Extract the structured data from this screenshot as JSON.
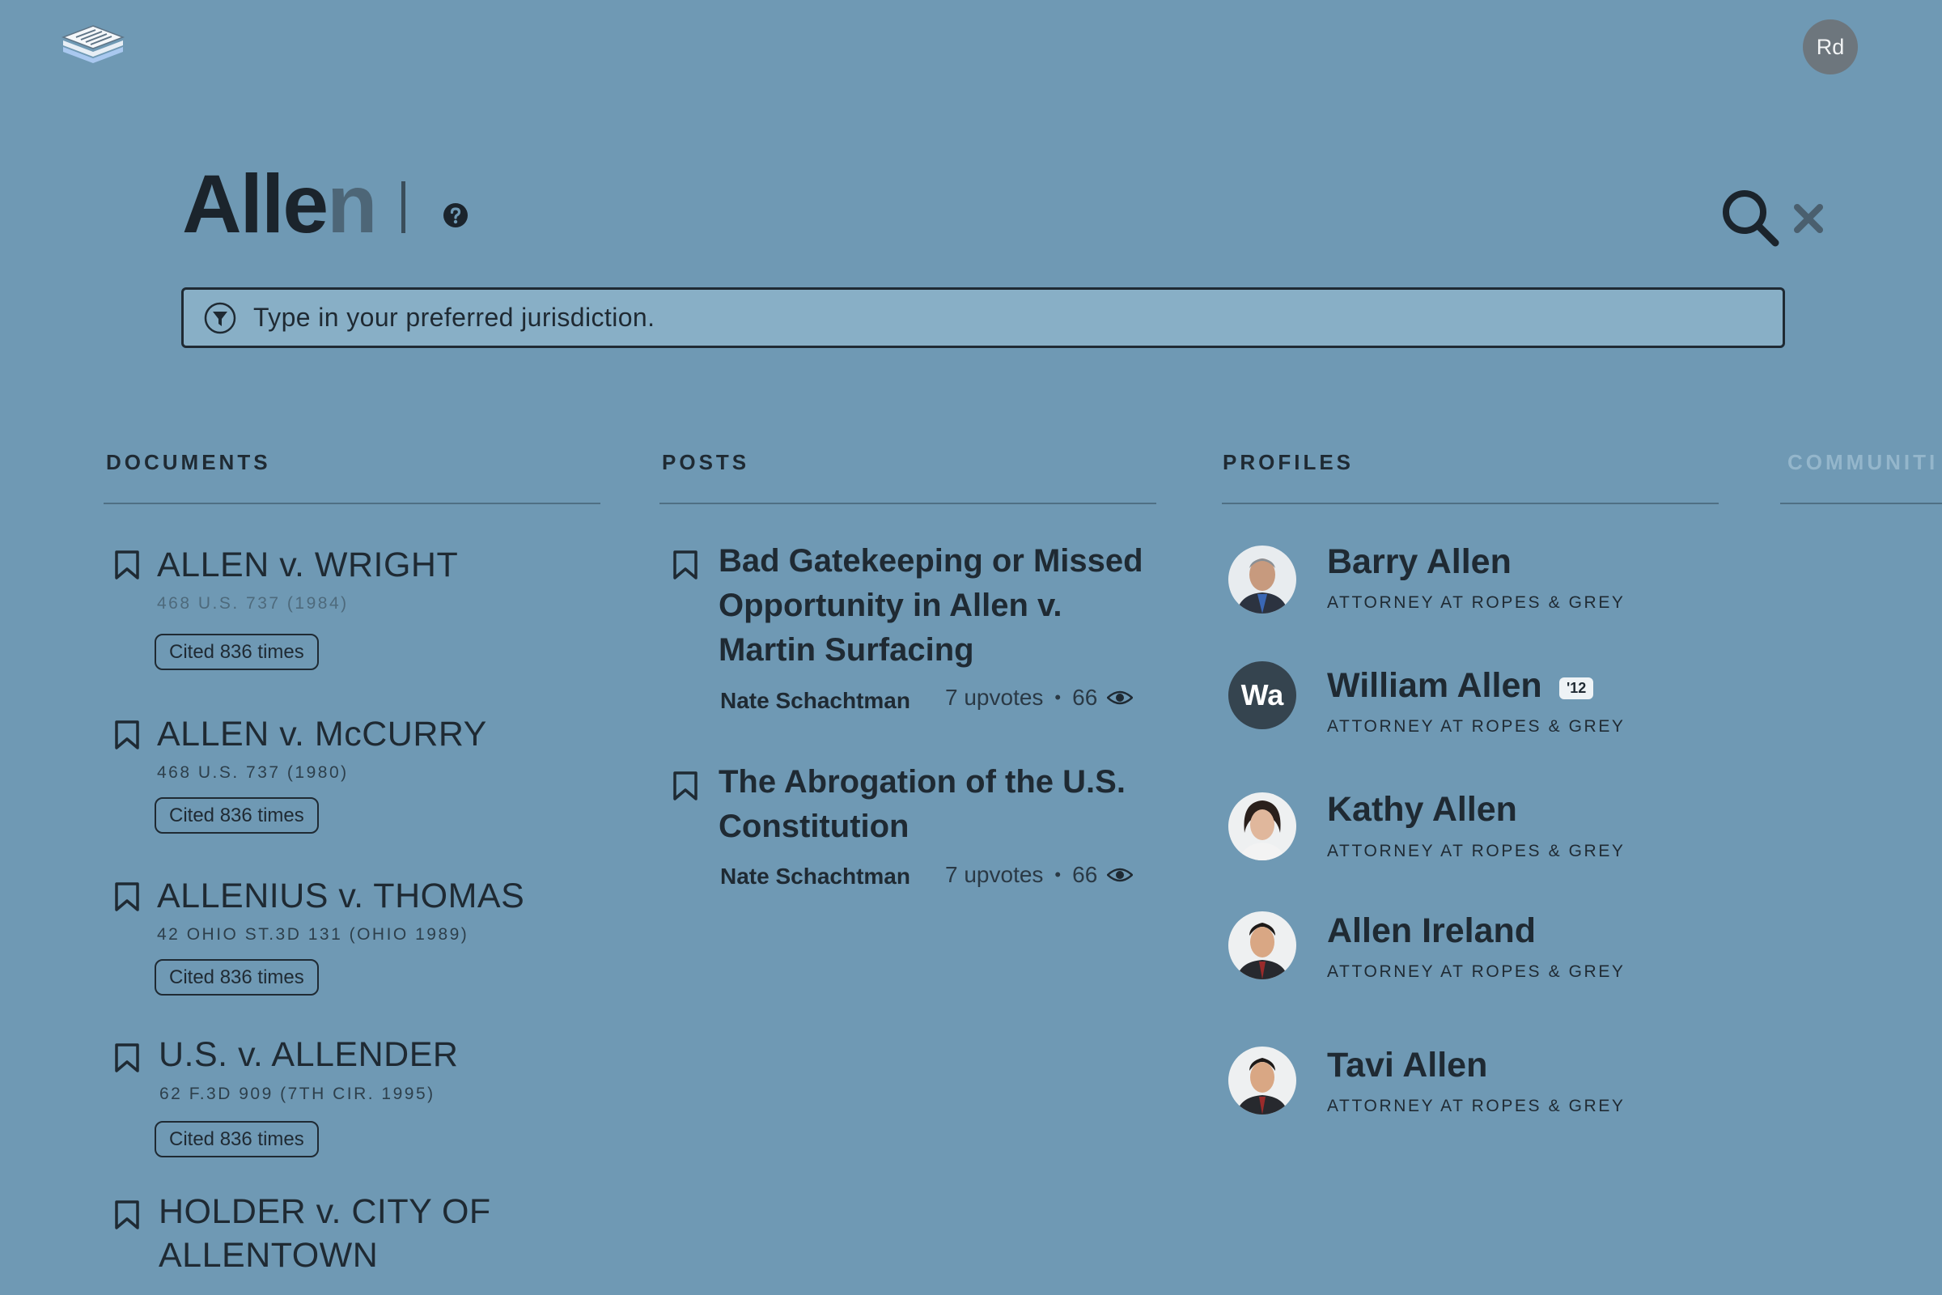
{
  "header": {
    "user_initials": "Rd",
    "query_typed": "Alle",
    "query_suggested": "n"
  },
  "filter": {
    "placeholder": "Type in your preferred jurisdiction."
  },
  "columns": {
    "documents": "DOCUMENTS",
    "posts": "POSTS",
    "profiles": "PROFILES",
    "communities": "COMMUNITI"
  },
  "documents": [
    {
      "title": "ALLEN v. WRIGHT",
      "citation": "468 U.S. 737 (1984)",
      "cited": "Cited 836 times"
    },
    {
      "title": "ALLEN v. McCURRY",
      "citation": "468 U.S. 737 (1980)",
      "cited": "Cited 836 times"
    },
    {
      "title": "ALLENIUS v. THOMAS",
      "citation": "42 OHIO ST.3D 131 (OHIO 1989)",
      "cited": "Cited 836 times"
    },
    {
      "title": "U.S. v. ALLENDER",
      "citation": "62 F.3D 909 (7TH CIR. 1995)",
      "cited": "Cited 836 times"
    },
    {
      "title_line1": "HOLDER v. CITY OF",
      "title_line2": "ALLENTOWN"
    }
  ],
  "posts": [
    {
      "title_lines": [
        "Bad Gatekeeping or Missed",
        "Opportunity in Allen v.",
        "Martin Surfacing"
      ],
      "author": "Nate Schachtman",
      "upvotes": "7 upvotes",
      "views": "66"
    },
    {
      "title_lines": [
        "The Abrogation of the U.S.",
        "Constitution"
      ],
      "author": "Nate Schachtman",
      "upvotes": "7 upvotes",
      "views": "66"
    }
  ],
  "stats_separator": "•",
  "profiles": [
    {
      "name": "Barry Allen",
      "role": "ATTORNEY AT ROPES & GREY",
      "avatar": "photo"
    },
    {
      "name": "William Allen",
      "role": "ATTORNEY AT ROPES & GREY",
      "avatar_initials": "Wa",
      "badge": "'12"
    },
    {
      "name": "Kathy Allen",
      "role": "ATTORNEY AT ROPES & GREY",
      "avatar": "photo"
    },
    {
      "name": "Allen Ireland",
      "role": "ATTORNEY AT ROPES & GREY",
      "avatar": "photo"
    },
    {
      "name": "Tavi Allen",
      "role": "ATTORNEY AT ROPES & GREY",
      "avatar": "photo"
    }
  ],
  "colors": {
    "background": "#6f99b4",
    "filter_bg": "#88afc6",
    "text": "#1f2a33",
    "faded_heading": "#94b6cb"
  },
  "icons": [
    "stack-logo-icon",
    "help-icon",
    "search-icon",
    "close-icon",
    "filter-icon",
    "bookmark-icon",
    "eye-icon"
  ]
}
